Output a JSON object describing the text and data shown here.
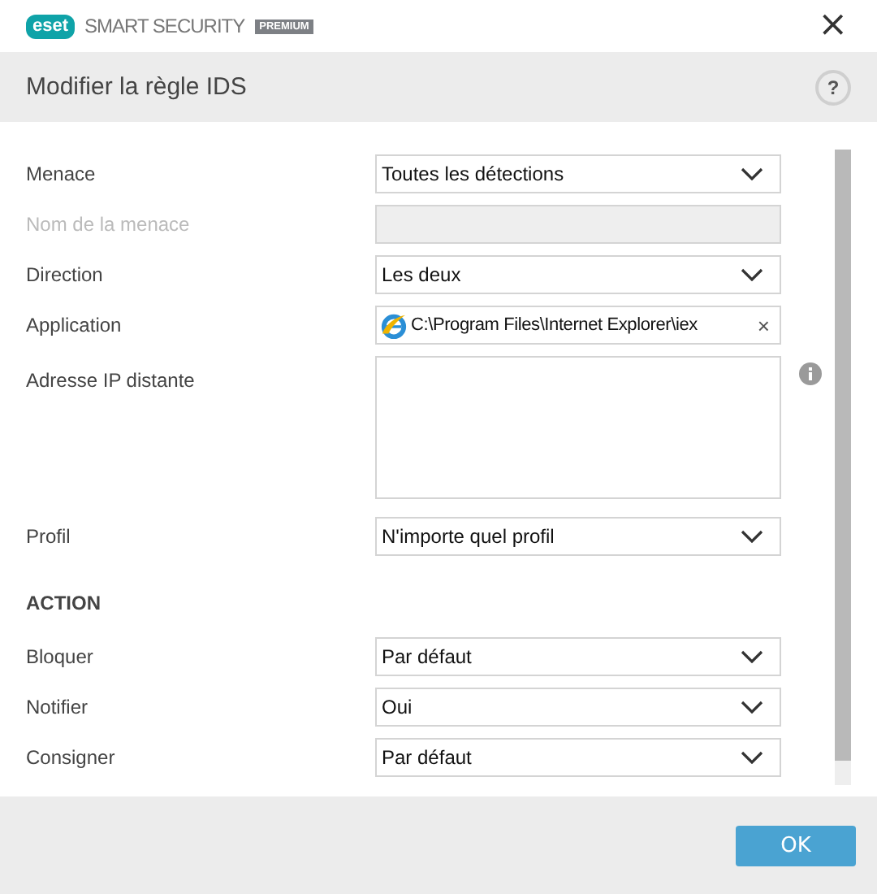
{
  "window": {
    "brand": "eset",
    "product": "SMART SECURITY",
    "edition": "PREMIUM",
    "close": "×"
  },
  "header": {
    "title": "Modifier la règle IDS",
    "help": "?"
  },
  "fields": [
    {
      "kind": "select",
      "label": "Menace",
      "value": "Toutes les détections",
      "disabled": false
    },
    {
      "kind": "text",
      "label": "Nom de la menace",
      "disabled": true
    },
    {
      "kind": "select",
      "label": "Direction",
      "value": "Les deux",
      "disabled": false
    },
    {
      "kind": "app",
      "label": "Application",
      "value": "C:\\Program Files\\Internet Explorer\\iex",
      "clear": "×",
      "disabled": false
    },
    {
      "kind": "textarea",
      "label": "Adresse IP distante",
      "disabled": false
    },
    {
      "kind": "select",
      "label": "Profil",
      "value": "N'importe quel profil",
      "disabled": false
    },
    {
      "kind": "heading",
      "label": "ACTION"
    },
    {
      "kind": "select",
      "label": "Bloquer",
      "value": "Par défaut",
      "disabled": false
    },
    {
      "kind": "select",
      "label": "Notifier",
      "value": "Oui",
      "disabled": false
    },
    {
      "kind": "select",
      "label": "Consigner",
      "value": "Par défaut",
      "disabled": false
    }
  ],
  "buttons": [
    "OK"
  ]
}
